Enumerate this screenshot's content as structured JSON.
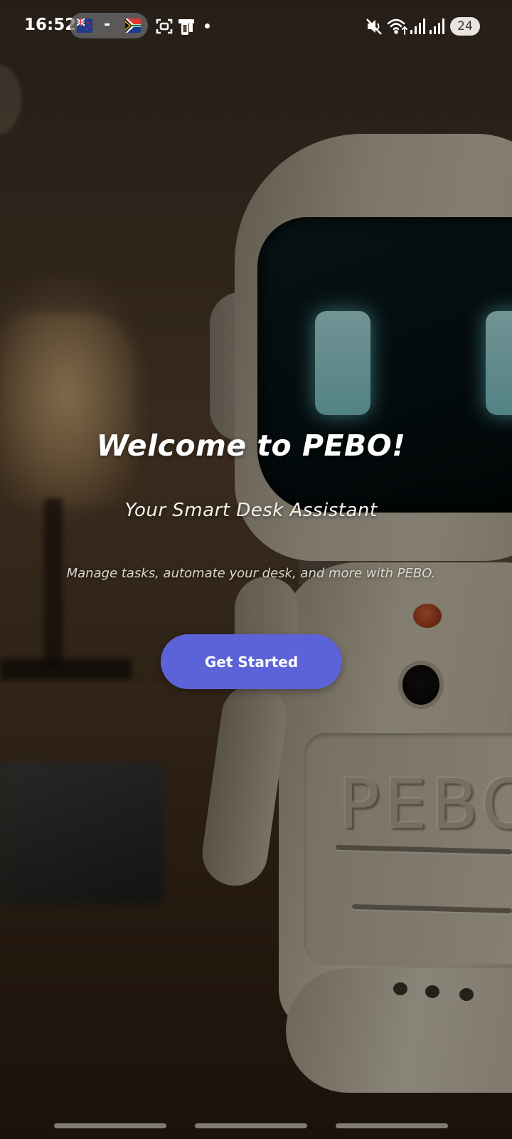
{
  "status_bar": {
    "time": "16:52",
    "notification_separator": "-",
    "flags": [
      "new-zealand-flag-icon",
      "south-africa-flag-icon"
    ],
    "icons": [
      "screenshot-icon",
      "device-icon",
      "mute-icon",
      "wifi-icon",
      "signal-icon",
      "signal-icon"
    ],
    "battery_level": "24"
  },
  "welcome": {
    "title": "Welcome to PEBO!",
    "subtitle": "Your Smart Desk Assistant",
    "description": "Manage tasks, automate your desk, and more with PEBO.",
    "button_label": "Get Started"
  },
  "background": {
    "robot_engraving": "PEBO"
  },
  "colors": {
    "accent": "#5c63d8",
    "text": "#ffffff"
  }
}
